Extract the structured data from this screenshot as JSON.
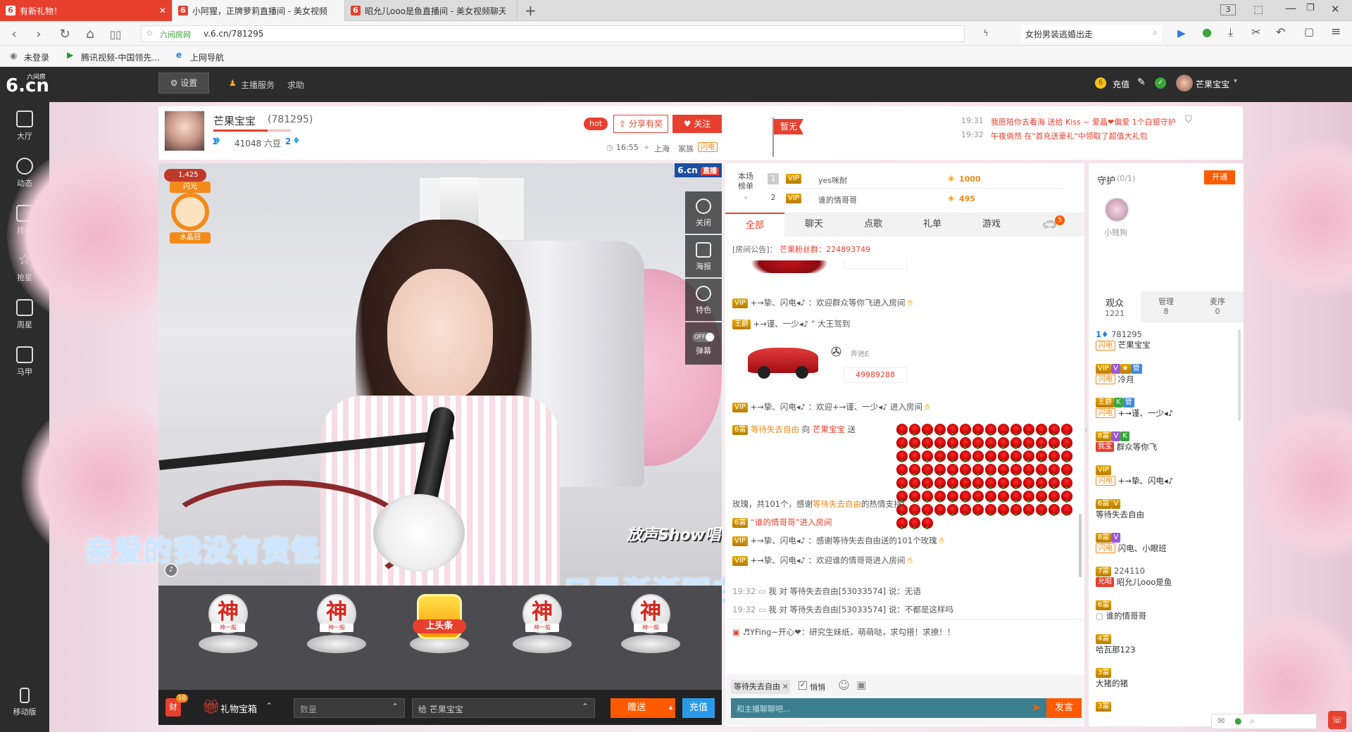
{
  "browser": {
    "tabs": [
      {
        "title": "有新礼物！",
        "active_red": true
      },
      {
        "title": "小阿猩，正牌萝莉直播间 - 美女视频"
      },
      {
        "title": "昭允儿ooo是鱼直播间 - 美女视频聊天"
      }
    ],
    "tab_count": "3",
    "url_site": "六间房网",
    "url": "v.6.cn/781295",
    "search_text": "女扮男装逃婚出走",
    "bookmarks": [
      "未登录",
      "腾讯视频-中国领先...",
      "上网导航"
    ]
  },
  "site": {
    "logo_main": "6.cn",
    "logo_small": "六间房",
    "settings": "设置",
    "anchor_service": "主播服务",
    "help": "求助",
    "recharge": "充值",
    "username": "芒果宝宝"
  },
  "leftnav": [
    "大厅",
    "动态",
    "排行",
    "抢星",
    "周星",
    "马甲"
  ],
  "leftnav_bottom": "移动版",
  "anchor": {
    "name": "芒果宝宝",
    "room_id": "(781295)",
    "level_left": "1",
    "beans": "41048 六豆",
    "level_right": "2",
    "hot": "hot",
    "share": "分享有奖",
    "follow": "关注",
    "time": "16:55",
    "city": "上海",
    "family_label": "家族",
    "family_badge": "闪电",
    "flag": "暂无"
  },
  "marquee": [
    {
      "time": "19:31",
      "text": "我愿陪你去看海 送给 Kiss ~ 爱晶❤偏爱 1个白银守护"
    },
    {
      "time": "19:32",
      "text": "午夜倘然 在\"首充送豪礼\"中领取了超值大礼包"
    }
  ],
  "video": {
    "badge_count": "1,425",
    "seal_top": "闪光",
    "seal_bottom": "水晶冠",
    "live_logo": "6.cn",
    "live_text": "直播",
    "lyric1": "亲爱的我没有责怪",
    "lyric2": "只是渐渐明白",
    "show_logo": "放声Show唱",
    "tools": [
      "关闭",
      "海报",
      "特色",
      "弹幕"
    ],
    "toggle": "OFF"
  },
  "gifts": [
    {
      "char": "神",
      "label": "神一般"
    },
    {
      "char": "神",
      "label": "神一般"
    },
    {
      "char": "上头条",
      "label": ""
    },
    {
      "char": "神",
      "label": "神一般"
    },
    {
      "char": "神",
      "label": "神一般"
    }
  ],
  "bottom": {
    "fortune": "财",
    "fortune_count": "10",
    "giftbox": "礼物宝箱",
    "qty_placeholder": "数量",
    "to_label": "给 芒果宝宝",
    "send_gift": "赠送",
    "recharge": "充值"
  },
  "rank": {
    "label": "本场榜单",
    "rows": [
      {
        "pos": "1",
        "name": "yes咪耐",
        "score": "1000"
      },
      {
        "pos": "2",
        "name": "谁的情哥哥",
        "score": "495"
      }
    ]
  },
  "chat_tabs": [
    "全部",
    "聊天",
    "点歌",
    "礼单",
    "游戏"
  ],
  "chat_tab_car_count": "5",
  "notice": {
    "label": "[房间公告]：",
    "text": "芒果粉丝群：224893749"
  },
  "chat": {
    "car1_num": "49989288",
    "car1_name": "奔驰E",
    "line1": "+→挚、闪电◂♪ ：欢迎群众等你飞进入房间",
    "line2": "+→谨、一少◂♪ ” 大王驾到",
    "line3": "+→挚、闪电◂♪ ：欢迎+→谨、一少◂♪ 进入房间",
    "gift_from": "等待失去自由",
    "gift_to": "芒果宝宝",
    "gift_verb": "向",
    "gift_send": "送",
    "rose_summary": "玫瑰，共101个，感谢",
    "rose_thanks_name": "等待失去自由",
    "rose_thanks_tail": "的热情支持!",
    "line4": "“谁的情哥哥”进入房间",
    "line5": "+→挚、闪电◂♪ ：感谢等待失去自由送的101个玫瑰",
    "line6": "+→挚、闪电◂♪ ：欢迎谁的情哥哥进入房间",
    "priv1_time": "19:32",
    "priv1": "我 对 等待失去自由[53033574] 说：无语",
    "priv2_time": "19:32",
    "priv2": "我 对 等待失去自由[53033574] 说：不都是这样吗",
    "sys": "♬YFing~开心❤：研究生妹纸，萌萌哒，求勾搭！求撩！！"
  },
  "chat_input": {
    "to": "等待失去自由",
    "private_label": "悄悄",
    "placeholder": "和主播聊聊吧...",
    "send": "发言"
  },
  "guard": {
    "title": "守护",
    "count": "(0/1)",
    "open": "开通",
    "member": "小贱狗"
  },
  "audience_tabs": [
    {
      "label": "观众",
      "count": "1221"
    },
    {
      "label": "管理",
      "count": "8"
    },
    {
      "label": "麦序",
      "count": "0"
    }
  ],
  "audience": [
    {
      "top": "781295",
      "name": "芒果宝宝"
    },
    {
      "top": "",
      "name": "冷月"
    },
    {
      "top": "",
      "name": "+→谨、一少◂♪"
    },
    {
      "top": "",
      "name": "群众等你飞"
    },
    {
      "top": "",
      "name": "+→挚、闪电◂♪"
    },
    {
      "top": "",
      "name": "等待失去自由"
    },
    {
      "top": "",
      "name": "闪电、小眼班"
    },
    {
      "top": "224110",
      "name": "昭允儿ooo是鱼"
    },
    {
      "top": "",
      "name": "谁的情哥哥"
    },
    {
      "top": "",
      "name": "哈瓦那123"
    },
    {
      "top": "",
      "name": "大猪的猪"
    }
  ],
  "colors": {
    "accent": "#e8402f",
    "orange": "#ff5a00",
    "dark": "#2c2c2c",
    "teal": "#3d7f8f"
  }
}
